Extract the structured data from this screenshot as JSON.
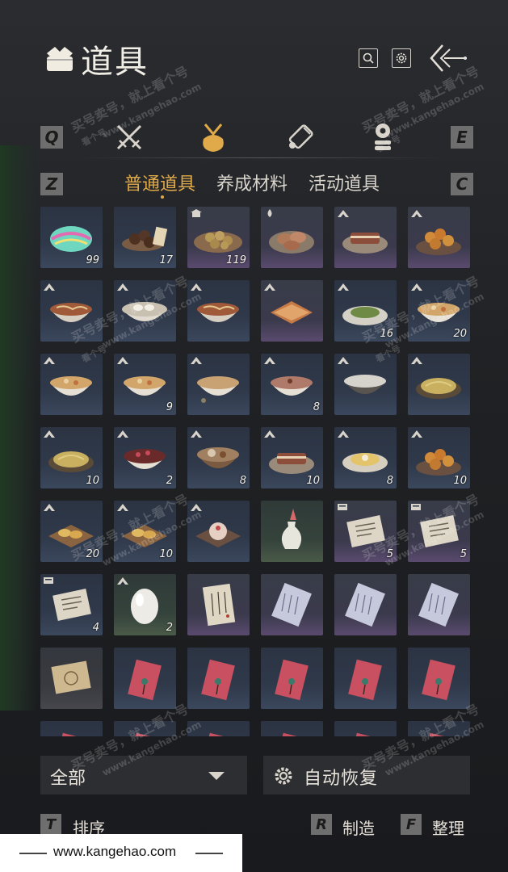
{
  "header": {
    "title": "道具",
    "search_icon": "search-icon",
    "settings_icon": "gear-icon",
    "back_icon": "back-arrow-icon"
  },
  "category_bar": {
    "prev_key": "Q",
    "next_key": "E",
    "tabs": [
      "swords-icon",
      "pouch-icon",
      "scroll-icon",
      "coin-stack-icon"
    ],
    "active_index": 1
  },
  "subtabs": {
    "prev_key": "Z",
    "next_key": "C",
    "items": [
      "普通道具",
      "养成材料",
      "活动道具"
    ],
    "active_index": 0
  },
  "grid": {
    "items": [
      {
        "icon": "jade-gem",
        "qty": "99",
        "rarity": "blue",
        "badge": ""
      },
      {
        "icon": "dark-pills",
        "qty": "17",
        "rarity": "blue",
        "badge": ""
      },
      {
        "icon": "dumpling-plate",
        "qty": "119",
        "rarity": "purple",
        "badge": "house"
      },
      {
        "icon": "pastry-plate",
        "qty": "",
        "rarity": "purple",
        "badge": "drop"
      },
      {
        "icon": "pork-plate",
        "qty": "",
        "rarity": "purple",
        "badge": "mountain"
      },
      {
        "icon": "fried-balls",
        "qty": "",
        "rarity": "purple",
        "badge": "mountain"
      },
      {
        "icon": "noodle-bowl",
        "qty": "",
        "rarity": "blue",
        "badge": "mountain"
      },
      {
        "icon": "dumpling-bowl",
        "qty": "",
        "rarity": "blue",
        "badge": "mountain"
      },
      {
        "icon": "noodle-bowl",
        "qty": "",
        "rarity": "blue",
        "badge": "mountain"
      },
      {
        "icon": "cake-square",
        "qty": "",
        "rarity": "purple",
        "badge": "mountain"
      },
      {
        "icon": "greens-plate",
        "qty": "16",
        "rarity": "blue",
        "badge": "mountain"
      },
      {
        "icon": "soup-bowl",
        "qty": "20",
        "rarity": "blue",
        "badge": "mountain"
      },
      {
        "icon": "soup-bowl",
        "qty": "",
        "rarity": "blue",
        "badge": "mountain"
      },
      {
        "icon": "soup-bowl",
        "qty": "9",
        "rarity": "blue",
        "badge": "mountain"
      },
      {
        "icon": "broth-bowl",
        "qty": "",
        "rarity": "blue",
        "badge": "mountain"
      },
      {
        "icon": "congee-bowl",
        "qty": "8",
        "rarity": "blue",
        "badge": "mountain"
      },
      {
        "icon": "rice-bowl",
        "qty": "",
        "rarity": "blue",
        "badge": "mountain"
      },
      {
        "icon": "noodle-plate",
        "qty": "",
        "rarity": "blue",
        "badge": "mountain"
      },
      {
        "icon": "noodle-plate",
        "qty": "10",
        "rarity": "blue",
        "badge": "mountain"
      },
      {
        "icon": "berry-bowl",
        "qty": "2",
        "rarity": "blue",
        "badge": "mountain"
      },
      {
        "icon": "stew-pot",
        "qty": "8",
        "rarity": "blue",
        "badge": "mountain"
      },
      {
        "icon": "pork-plate",
        "qty": "10",
        "rarity": "blue",
        "badge": "mountain"
      },
      {
        "icon": "egg-plate",
        "qty": "8",
        "rarity": "blue",
        "badge": "mountain"
      },
      {
        "icon": "fried-balls",
        "qty": "10",
        "rarity": "blue",
        "badge": "mountain"
      },
      {
        "icon": "snack-tray",
        "qty": "20",
        "rarity": "blue",
        "badge": "mountain"
      },
      {
        "icon": "snack-tray",
        "qty": "10",
        "rarity": "blue",
        "badge": "mountain"
      },
      {
        "icon": "bun-tray",
        "qty": "",
        "rarity": "blue",
        "badge": "mountain"
      },
      {
        "icon": "vase",
        "qty": "",
        "rarity": "green",
        "badge": ""
      },
      {
        "icon": "paper-note",
        "qty": "5",
        "rarity": "purple",
        "badge": "scroll"
      },
      {
        "icon": "paper-note",
        "qty": "5",
        "rarity": "purple",
        "badge": "scroll"
      },
      {
        "icon": "paper-note",
        "qty": "4",
        "rarity": "blue",
        "badge": "scroll"
      },
      {
        "icon": "egg",
        "qty": "2",
        "rarity": "green",
        "badge": "mountain"
      },
      {
        "icon": "letter",
        "qty": "",
        "rarity": "purple",
        "badge": ""
      },
      {
        "icon": "blue-letter",
        "qty": "",
        "rarity": "purple",
        "badge": ""
      },
      {
        "icon": "blue-letter",
        "qty": "",
        "rarity": "purple",
        "badge": ""
      },
      {
        "icon": "blue-letter",
        "qty": "",
        "rarity": "purple",
        "badge": ""
      },
      {
        "icon": "old-scroll",
        "qty": "",
        "rarity": "white",
        "badge": ""
      },
      {
        "icon": "red-envelope",
        "qty": "",
        "rarity": "blue",
        "badge": ""
      },
      {
        "icon": "red-envelope",
        "qty": "",
        "rarity": "blue",
        "badge": ""
      },
      {
        "icon": "red-envelope",
        "qty": "",
        "rarity": "blue",
        "badge": ""
      },
      {
        "icon": "red-envelope",
        "qty": "",
        "rarity": "blue",
        "badge": ""
      },
      {
        "icon": "red-envelope",
        "qty": "",
        "rarity": "blue",
        "badge": ""
      },
      {
        "icon": "red-envelope",
        "qty": "",
        "rarity": "blue",
        "badge": ""
      },
      {
        "icon": "red-envelope",
        "qty": "",
        "rarity": "blue",
        "badge": ""
      },
      {
        "icon": "red-envelope",
        "qty": "",
        "rarity": "blue",
        "badge": ""
      },
      {
        "icon": "red-envelope",
        "qty": "",
        "rarity": "blue",
        "badge": ""
      },
      {
        "icon": "red-envelope",
        "qty": "",
        "rarity": "blue",
        "badge": ""
      },
      {
        "icon": "red-envelope",
        "qty": "",
        "rarity": "blue",
        "badge": ""
      }
    ]
  },
  "bottom": {
    "filter_label": "全部",
    "filter_icon": "chevron-down-icon",
    "auto_restore_label": "自动恢复",
    "auto_restore_icon": "gear-icon",
    "actions": [
      {
        "key": "T",
        "label": "排序"
      },
      {
        "key": "R",
        "label": "制造"
      },
      {
        "key": "F",
        "label": "整理"
      }
    ]
  },
  "watermarks": {
    "main": "买号卖号，就上看个号",
    "url": "www.kangehao.com",
    "small": "看个号"
  },
  "footer": {
    "url": "www.kangehao.com"
  },
  "colors": {
    "accent": "#e0aa4a",
    "text": "#e6e2d8",
    "key_bg": "#6e6e6e"
  }
}
